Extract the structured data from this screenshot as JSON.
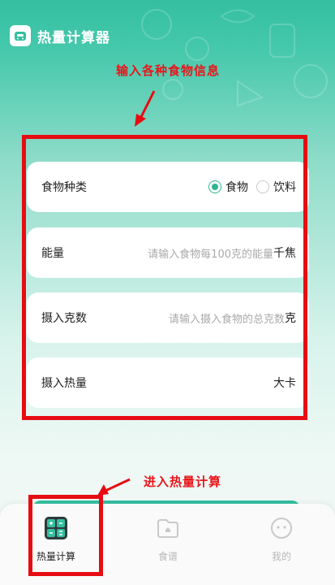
{
  "app": {
    "title": "热量计算器"
  },
  "annotations": {
    "top": "输入各种食物信息",
    "bottom": "进入热量计算"
  },
  "form": {
    "food_type": {
      "label": "食物种类",
      "options": [
        "食物",
        "饮料"
      ],
      "selected": "食物"
    },
    "energy": {
      "label": "能量",
      "placeholder": "请输入食物每100克的能量",
      "unit": "千焦"
    },
    "intake_grams": {
      "label": "摄入克数",
      "placeholder": "请输入摄入食物的总克数",
      "unit": "克"
    },
    "intake_calories": {
      "label": "摄入热量",
      "unit": "大卡"
    }
  },
  "tabbar": {
    "items": [
      {
        "label": "热量计算",
        "icon": "calculator-icon",
        "active": true
      },
      {
        "label": "食谱",
        "icon": "folder-icon",
        "active": false
      },
      {
        "label": "我的",
        "icon": "face-icon",
        "active": false
      }
    ]
  },
  "colors": {
    "brand": "#34bfa0",
    "annotation_red": "#e60d12",
    "radio_checked": "#2fb593"
  }
}
